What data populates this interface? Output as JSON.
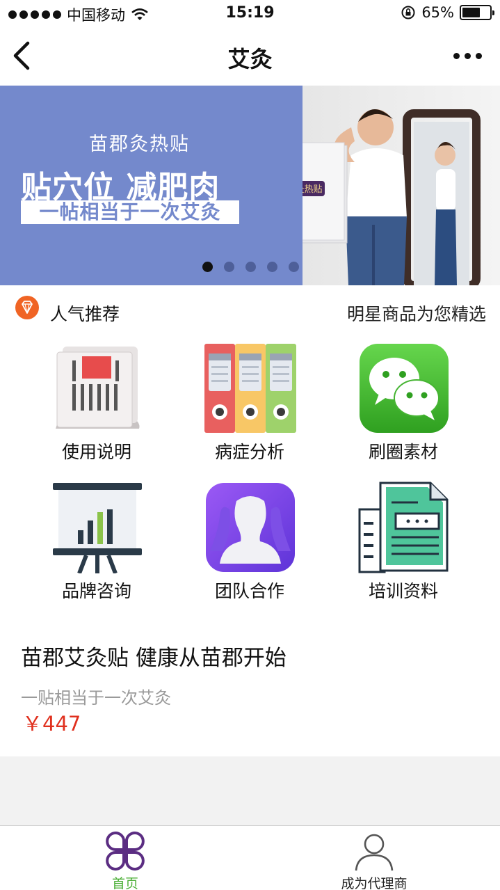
{
  "status_bar": {
    "carrier": "中国移动",
    "time": "15:19",
    "battery": "65%",
    "battery_level": 0.65
  },
  "nav": {
    "title": "艾灸",
    "back_icon": "chevron-left-icon",
    "more_icon": "more-dots-icon"
  },
  "banner": {
    "brand": "苗郡灸热贴",
    "headline": "贴穴位  减肥肉",
    "subline": "一帖相当于一次艾灸",
    "box_label": "苗郡灸热贴",
    "slide_count": 5,
    "active_slide": 1,
    "colors": {
      "background": "#7489cc"
    }
  },
  "section": {
    "icon": "diamond-icon",
    "title": "人气推荐",
    "hint": "明星商品为您精选"
  },
  "grid": [
    {
      "label": "使用说明",
      "icon": "newspaper-icon"
    },
    {
      "label": "病症分析",
      "icon": "binders-icon"
    },
    {
      "label": "刷圈素材",
      "icon": "wechat-icon"
    },
    {
      "label": "品牌咨询",
      "icon": "presentation-chart-icon"
    },
    {
      "label": "团队合作",
      "icon": "team-profile-icon"
    },
    {
      "label": "培训资料",
      "icon": "document-building-icon"
    }
  ],
  "product": {
    "title": "苗郡艾灸贴 健康从苗郡开始",
    "subtitle": "一贴相当于一次艾灸",
    "price": "￥447"
  },
  "tabs": [
    {
      "label": "首页",
      "icon": "clover-home-icon",
      "active": true
    },
    {
      "label": "成为代理商",
      "icon": "person-icon",
      "active": false
    }
  ],
  "colors": {
    "accent_green": "#4caf37",
    "accent_purple": "#5b2d82",
    "price_red": "#e0301e",
    "orange": "#f06424"
  }
}
